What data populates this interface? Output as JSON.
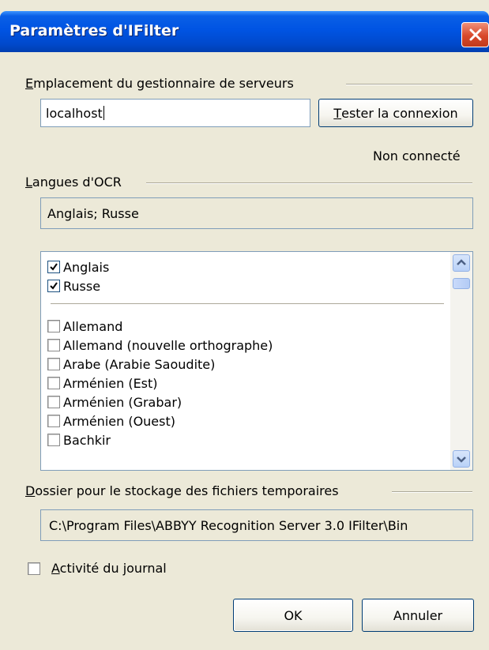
{
  "window": {
    "title": "Paramètres d'IFilter"
  },
  "server": {
    "group_label_first": "E",
    "group_label_rest": "mplacement du gestionnaire de serveurs",
    "host_value": "localhost",
    "test_button_first": "T",
    "test_button_rest": "ester la connexion",
    "status": "Non connecté"
  },
  "ocr": {
    "group_label_first": "L",
    "group_label_rest": "angues d'OCR",
    "selected_summary": "Anglais; Russe",
    "checked_languages": [
      {
        "label": "Anglais",
        "checked": true
      },
      {
        "label": "Russe",
        "checked": true
      }
    ],
    "languages": [
      {
        "label": "Allemand",
        "checked": false
      },
      {
        "label": "Allemand (nouvelle orthographe)",
        "checked": false
      },
      {
        "label": "Arabe (Arabie Saoudite)",
        "checked": false
      },
      {
        "label": "Arménien (Est)",
        "checked": false
      },
      {
        "label": "Arménien (Grabar)",
        "checked": false
      },
      {
        "label": "Arménien (Ouest)",
        "checked": false
      },
      {
        "label": "Bachkir",
        "checked": false
      }
    ]
  },
  "temp_folder": {
    "group_label_first": "D",
    "group_label_rest": "ossier pour le stockage des fichiers temporaires",
    "path": "C:\\Program Files\\ABBYY Recognition Server 3.0 IFilter\\Bin"
  },
  "log": {
    "label_first": "A",
    "label_rest": "ctivité du journal",
    "checked": false
  },
  "buttons": {
    "ok": "OK",
    "cancel": "Annuler"
  },
  "icons": {
    "close": "close-icon",
    "check": "checkmark-icon",
    "scroll_up": "arrow-up-icon",
    "scroll_down": "arrow-down-icon"
  },
  "colors": {
    "title_bar": "#0054e3",
    "dialog_bg": "#ece9d8",
    "close_button": "#d8482a"
  }
}
